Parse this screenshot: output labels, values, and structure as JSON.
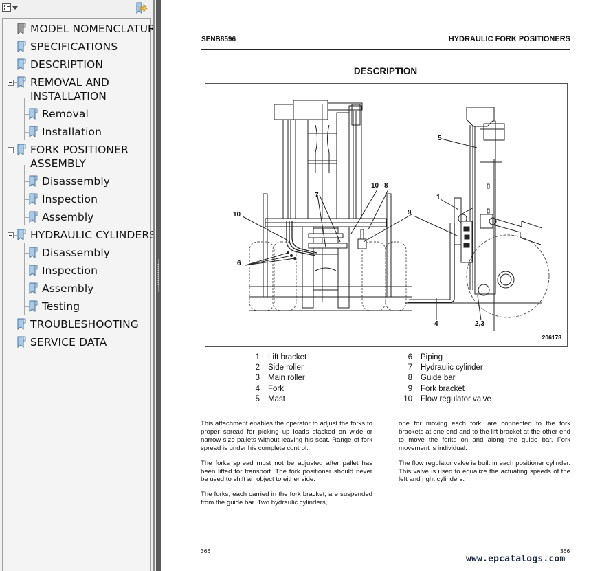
{
  "sidebar": {
    "options_button": "bookmark-options",
    "goto_button": "expand-current-bookmark",
    "items": [
      {
        "label": "MODEL NOMENCLATURE",
        "level": 0,
        "current": true
      },
      {
        "label": "SPECIFICATIONS",
        "level": 0
      },
      {
        "label": "DESCRIPTION",
        "level": 0
      },
      {
        "label": "REMOVAL AND",
        "label2": "INSTALLATION",
        "level": 0,
        "expanded": true
      },
      {
        "label": "Removal",
        "level": 1
      },
      {
        "label": "Installation",
        "level": 1
      },
      {
        "label": "FORK POSITIONER",
        "label2": "ASSEMBLY",
        "level": 0,
        "expanded": true
      },
      {
        "label": "Disassembly",
        "level": 1
      },
      {
        "label": "Inspection",
        "level": 1
      },
      {
        "label": "Assembly",
        "level": 1
      },
      {
        "label": "HYDRAULIC CYLINDERS",
        "level": 0,
        "expanded": true
      },
      {
        "label": "Disassembly",
        "level": 1
      },
      {
        "label": "Inspection",
        "level": 1
      },
      {
        "label": "Assembly",
        "level": 1
      },
      {
        "label": "Testing",
        "level": 1
      },
      {
        "label": "TROUBLESHOOTING",
        "level": 0
      },
      {
        "label": "SERVICE DATA",
        "level": 0
      }
    ]
  },
  "page": {
    "doc_code": "SENB8596",
    "section_title": "HYDRAULIC FORK POSITIONERS",
    "title": "DESCRIPTION",
    "figure": {
      "id": "206178",
      "callouts": [
        "10",
        "7",
        "10",
        "8",
        "9",
        "6",
        "5",
        "1",
        "9",
        "4",
        "2,3"
      ]
    },
    "legend": [
      {
        "num": "1",
        "text": "Lift bracket"
      },
      {
        "num": "2",
        "text": "Side roller"
      },
      {
        "num": "3",
        "text": "Main roller"
      },
      {
        "num": "4",
        "text": "Fork"
      },
      {
        "num": "5",
        "text": "Mast"
      },
      {
        "num": "6",
        "text": "Piping"
      },
      {
        "num": "7",
        "text": "Hydraulic cylinder"
      },
      {
        "num": "8",
        "text": "Guide bar"
      },
      {
        "num": "9",
        "text": "Fork bracket"
      },
      {
        "num": "10",
        "text": "Flow regulator valve"
      }
    ],
    "paragraphs_left": [
      "This attachment enables the operator to adjust the forks to proper spread for picking up loads stacked on wide or narrow size pallets without leaving his seat. Range of fork spread is under his complete control.",
      "The forks spread must not be adjusted after pallet has been lifted for transport. The fork positioner should never be used to shift an object to either side.",
      "The forks, each carried in the fork bracket, are suspended from the guide bar. Two hydraulic cylinders,"
    ],
    "paragraphs_right": [
      "one for moving each fork, are connected to the fork brackets at one end and to the lift bracket at the other end to move the forks on and along the guide bar. Fork movement is individual.",
      "The flow regulator valve is built in each positioner cylinder. This valve is used to equalize the actuating speeds of the left and right cylinders."
    ],
    "page_number_left": "366",
    "page_number_right": "366"
  },
  "watermark": "www.epcatalogs.com"
}
